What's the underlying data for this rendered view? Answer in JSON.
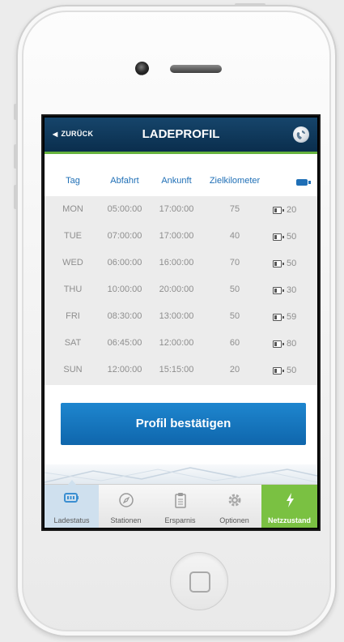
{
  "nav": {
    "back_label": "ZURÜCK",
    "title": "LADEPROFIL"
  },
  "table": {
    "headers": [
      "Tag",
      "Abfahrt",
      "Ankunft",
      "Zielkilometer"
    ],
    "rows": [
      {
        "day": "MON",
        "departure": "05:00:00",
        "arrival": "17:00:00",
        "km": "75",
        "battery": "20"
      },
      {
        "day": "TUE",
        "departure": "07:00:00",
        "arrival": "17:00:00",
        "km": "40",
        "battery": "50"
      },
      {
        "day": "WED",
        "departure": "06:00:00",
        "arrival": "16:00:00",
        "km": "70",
        "battery": "50"
      },
      {
        "day": "THU",
        "departure": "10:00:00",
        "arrival": "20:00:00",
        "km": "50",
        "battery": "30"
      },
      {
        "day": "FRI",
        "departure": "08:30:00",
        "arrival": "13:00:00",
        "km": "50",
        "battery": "59"
      },
      {
        "day": "SAT",
        "departure": "06:45:00",
        "arrival": "12:00:00",
        "km": "60",
        "battery": "80"
      },
      {
        "day": "SUN",
        "departure": "12:00:00",
        "arrival": "15:15:00",
        "km": "20",
        "battery": "50"
      }
    ]
  },
  "confirm_label": "Profil bestätigen",
  "tabs": [
    {
      "label": "Ladestatus",
      "icon": "battery-icon",
      "active": true
    },
    {
      "label": "Stationen",
      "icon": "compass-icon"
    },
    {
      "label": "Ersparnis",
      "icon": "clipboard-icon"
    },
    {
      "label": "Optionen",
      "icon": "gear-icon"
    },
    {
      "label": "Netzzustand",
      "icon": "lightning-icon",
      "highlight": true
    }
  ],
  "colors": {
    "accent_blue": "#1f6fb6",
    "header_bg": "#0a2e4d",
    "green": "#7ac142",
    "button_blue": "#1577bf"
  }
}
